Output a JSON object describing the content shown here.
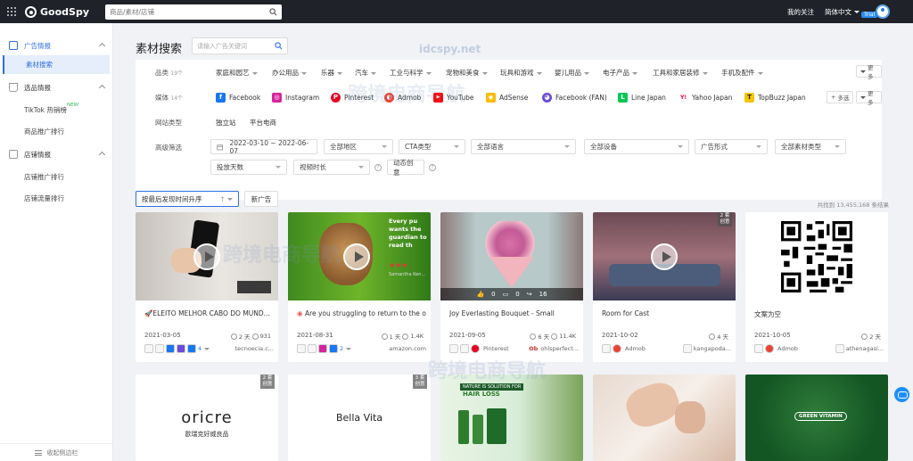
{
  "topbar": {
    "brand": "GoodSpy",
    "search_placeholder": "商品/素材/店铺",
    "my_follow": "我的关注",
    "language": "简体中文",
    "trial_badge": "Trial"
  },
  "sidebar": {
    "groups": [
      {
        "label": "广告情报",
        "items": [
          {
            "label": "素材搜索"
          }
        ]
      },
      {
        "label": "选品情报",
        "items": [
          {
            "label": "TikTok 热销榜",
            "badge": "NEW"
          },
          {
            "label": "商品推广排行"
          }
        ]
      },
      {
        "label": "店铺情报",
        "items": [
          {
            "label": "店铺推广排行"
          },
          {
            "label": "店铺流量排行"
          }
        ]
      }
    ],
    "collapse_label": "收起侧边栏"
  },
  "main": {
    "title": "素材搜索",
    "keyword_placeholder": "请输入广告关键词"
  },
  "filters": {
    "category_label": "品类",
    "category_count": "19个",
    "categories": [
      "家庭和园艺",
      "办公用品",
      "乐器",
      "汽车",
      "工业与科学",
      "宠物和美食",
      "玩具和游戏",
      "婴儿用品",
      "电子产品",
      "工具和家居装修",
      "手机及配件"
    ],
    "more": "更多",
    "media_label": "媒体",
    "media_count": "14个",
    "media": [
      {
        "name": "Facebook",
        "color": "#1877f2",
        "glyph": "f"
      },
      {
        "name": "Instagram",
        "color": "#d6249f",
        "glyph": "◎"
      },
      {
        "name": "Pinterest",
        "color": "#e60023",
        "glyph": "P"
      },
      {
        "name": "Admob",
        "color": "#ea4335",
        "glyph": "◐"
      },
      {
        "name": "YouTube",
        "color": "#ff0000",
        "glyph": "▶"
      },
      {
        "name": "AdSense",
        "color": "#fbbc04",
        "glyph": "◆"
      },
      {
        "name": "Facebook (FAN)",
        "color": "#6a4cd8",
        "glyph": "◕"
      },
      {
        "name": "Line Japan",
        "color": "#06c755",
        "glyph": "L"
      },
      {
        "name": "Yahoo Japan",
        "color": "#ff0033",
        "glyph": "Y!"
      },
      {
        "name": "TopBuzz Japan",
        "color": "#f5c400",
        "glyph": "T"
      }
    ],
    "multi_select": "多选",
    "site_label": "网站类型",
    "sites": [
      "独立站",
      "平台电商"
    ],
    "advanced_label": "高级筛选",
    "date_range": "2022-03-10 ~ 2022-06-07",
    "region": "全部地区",
    "cta": "CTA类型",
    "language": "全部语言",
    "device": "全部设备",
    "ad_format": "广告形式",
    "material_type": "全部素材类型",
    "days": "投放天数",
    "video_length": "视频时长",
    "dynamic": "动态创意"
  },
  "toolbar": {
    "sort": "按最后发现时间升序",
    "new_ads": "新广告",
    "result_count": "共找到 13,455,168 条结果"
  },
  "cards": [
    {
      "title": "🚀ELEITO MELHOR CABO DO MUND...",
      "date": "2021-03-05",
      "days": "2 天",
      "views": "931",
      "count": "4",
      "site": "tecnoecia.c..."
    },
    {
      "title": "Are you struggling to return to the offi...",
      "date": "2021-08-31",
      "days": "1 天",
      "views": "1.4K",
      "count": "2",
      "site": "amazon.com",
      "overlay": "Every pu wants the guardian to read th",
      "caption": "Samantha Ken..."
    },
    {
      "title": "Joy Everlasting Bouquet - Small",
      "date": "2021-09-05",
      "days": "6 天",
      "views": "11.4K",
      "platform": "Pinterest",
      "site": "ohlsperfect...",
      "likes": "0",
      "comments": "0",
      "shares": "16"
    },
    {
      "title": "Room for Cast",
      "date": "2021-10-02",
      "days": "4 天",
      "platform": "Admob",
      "site": "kangapoda...",
      "badge": "2 套 创意"
    },
    {
      "title": "文案为空",
      "date": "2021-10-05",
      "days": "2 天",
      "platform": "Admob",
      "site": "athenagasi..."
    }
  ],
  "row2": [
    {
      "brand": "oricre",
      "sub": "歐瑞克好威良品",
      "badge": "2 套 创意"
    },
    {
      "brand": "Bella Vita",
      "badge": "3 套 创意"
    },
    {
      "headline": "NATURE IS SOLUTION FOR",
      "headline2": "HAIR LOSS"
    },
    {},
    {
      "logo": "GREEN VITAMIN"
    }
  ],
  "watermarks": [
    "idcspy.net",
    "跨境电商导航"
  ]
}
